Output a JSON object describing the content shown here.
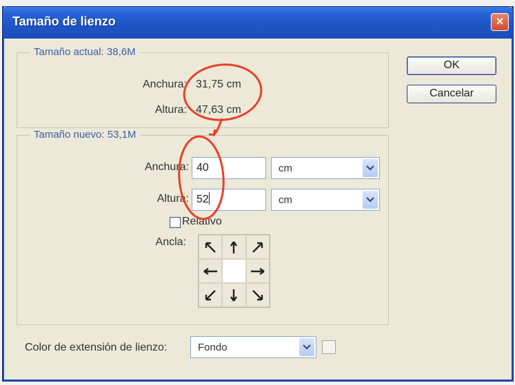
{
  "window": {
    "title": "Tamaño de lienzo",
    "close_glyph": "×"
  },
  "current_size": {
    "legend": "Tamaño actual: 38,6M",
    "width_label": "Anchura:",
    "width_value": "31,75 cm",
    "height_label": "Altura:",
    "height_value": "47,63 cm"
  },
  "new_size": {
    "legend": "Tamaño nuevo: 53,1M",
    "width_label": "Anchura:",
    "width_value": "40",
    "width_unit": "cm",
    "height_label": "Altura:",
    "height_value": "52",
    "height_unit": "cm",
    "relative_label": "Relativo",
    "relative_checked": false,
    "anchor_label": "Ancla:"
  },
  "buttons": {
    "ok": "OK",
    "cancel": "Cancelar"
  },
  "extension": {
    "label": "Color de extensión de lienzo:",
    "value": "Fondo"
  },
  "anchor_icons": [
    "arrow-nw-icon",
    "arrow-n-icon",
    "arrow-ne-icon",
    "arrow-w-icon",
    "anchor-center",
    "arrow-e-icon",
    "arrow-sw-icon",
    "arrow-s-icon",
    "arrow-se-icon"
  ],
  "colors": {
    "title_bar": "#1f56c6",
    "dialog_bg": "#ece9d8",
    "legend_text": "#3a5ea8",
    "annotation": "#e8402a"
  }
}
